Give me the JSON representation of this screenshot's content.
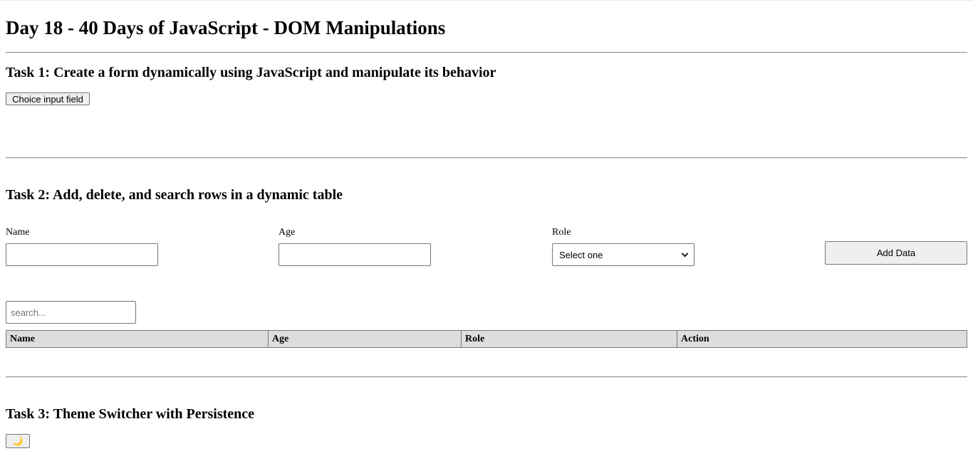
{
  "page": {
    "title": "Day 18 - 40 Days of JavaScript - DOM Manipulations"
  },
  "task1": {
    "heading": "Task 1: Create a form dynamically using JavaScript and manipulate its behavior",
    "choice_button_label": "Choice input field"
  },
  "task2": {
    "heading": "Task 2: Add, delete, and search rows in a dynamic table",
    "name_label": "Name",
    "name_value": "",
    "age_label": "Age",
    "age_value": "",
    "role_label": "Role",
    "role_selected": "Select one",
    "add_button_label": "Add Data",
    "search_placeholder": "search...",
    "search_value": "",
    "table": {
      "columns": [
        "Name",
        "Age",
        "Role",
        "Action"
      ],
      "rows": []
    }
  },
  "task3": {
    "heading": "Task 3: Theme Switcher with Persistence",
    "theme_icon": "moon-icon",
    "theme_toggle_glyph": "🌙"
  }
}
